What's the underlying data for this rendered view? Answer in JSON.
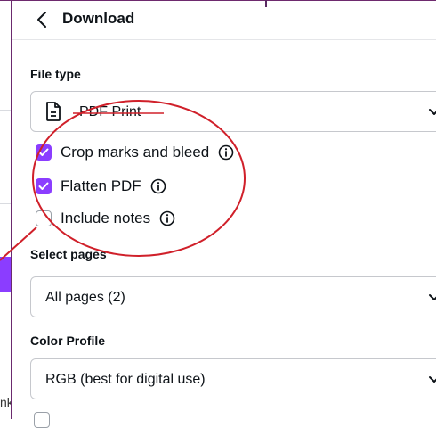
{
  "header": {
    "title": "Download"
  },
  "file_type": {
    "label": "File type",
    "value": "PDF Print"
  },
  "options": [
    {
      "label": "Crop marks and bleed",
      "checked": true
    },
    {
      "label": "Flatten PDF",
      "checked": true
    },
    {
      "label": "Include notes",
      "checked": false
    }
  ],
  "select_pages": {
    "label": "Select pages",
    "value": "All pages (2)"
  },
  "color_profile": {
    "label": "Color Profile",
    "value": "RGB (best for digital use)"
  },
  "background": {
    "partial_text": "nk"
  },
  "colors": {
    "accent": "#8b3dff",
    "annotation": "#d0202a",
    "frame": "#6b2a6e"
  }
}
